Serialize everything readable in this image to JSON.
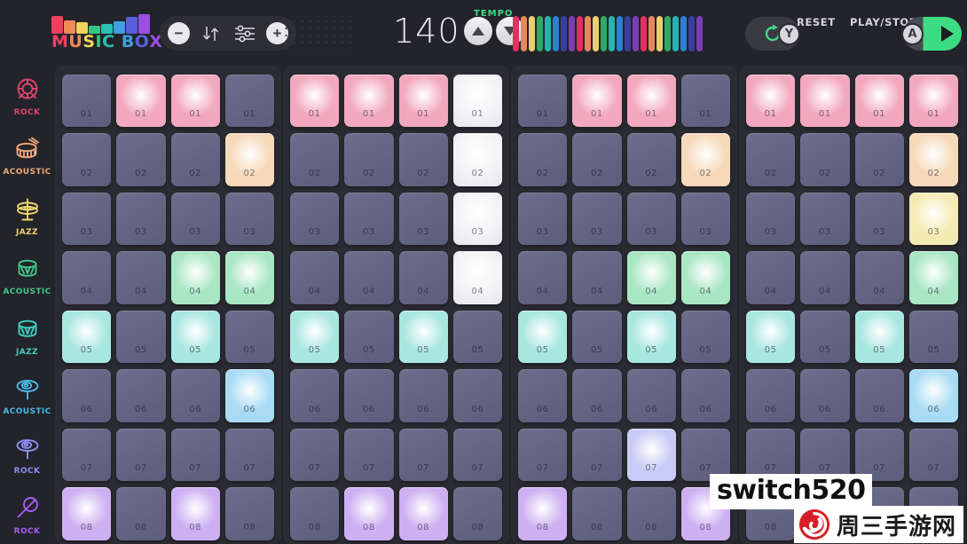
{
  "header": {
    "logo": {
      "text_parts": [
        {
          "ch": "M",
          "color": "#ef4060"
        },
        {
          "ch": "U",
          "color": "#f28a5a"
        },
        {
          "ch": "S",
          "color": "#f2d45a"
        },
        {
          "ch": "I",
          "color": "#34c77b"
        },
        {
          "ch": "C",
          "color": "#2bbfb0"
        },
        {
          "ch": " ",
          "color": "#ffffff"
        },
        {
          "ch": "B",
          "color": "#3f9fe0"
        },
        {
          "ch": "O",
          "color": "#5a5fd8"
        },
        {
          "ch": "X",
          "color": "#9a4fe0"
        }
      ],
      "bars": [
        {
          "color": "#ef4060",
          "height": 20
        },
        {
          "color": "#f28a5a",
          "height": 15
        },
        {
          "color": "#f2d45a",
          "height": 13
        },
        {
          "color": "#34c77b",
          "height": 9
        },
        {
          "color": "#2bbfb0",
          "height": 11
        },
        {
          "color": "#3f9fe0",
          "height": 14
        },
        {
          "color": "#5a5fd8",
          "height": 19
        },
        {
          "color": "#9a4fe0",
          "height": 22
        }
      ]
    },
    "toolbar": {
      "minus_label": "−",
      "plus_label": "+",
      "sort_icon_name": "sort-up-down-icon",
      "settings_icon_name": "sliders-icon"
    },
    "tempo": {
      "value": "140",
      "label": "TEMPO",
      "label_color": "#3ddc84",
      "up_name": "tempo-up-button",
      "down_name": "tempo-down-button"
    },
    "visualizer": {
      "palette": [
        "#e0315f",
        "#e5895c",
        "#e9cf72",
        "#2fa86a",
        "#27b3b0",
        "#2f7fd0",
        "#3a3f9e",
        "#7a3fb0"
      ],
      "bar_count": 24
    },
    "reset": {
      "label": "RESET",
      "badge": "Y",
      "icon_name": "refresh-icon",
      "accent": "#3ddc84"
    },
    "play": {
      "label": "PLAY/STOP",
      "badge": "A",
      "icon_name": "play-icon",
      "accent": "#3ddc84"
    }
  },
  "sidebar": {
    "items": [
      {
        "label": "ROCK",
        "color": "#e0436e",
        "icon": "rock-kick-drum-icon"
      },
      {
        "label": "ACOUSTIC",
        "color": "#f0a878",
        "icon": "acoustic-snare-drum-icon"
      },
      {
        "label": "JAZZ",
        "color": "#ecd66a",
        "icon": "jazz-hihat-icon"
      },
      {
        "label": "ACOUSTIC",
        "color": "#3fc98b",
        "icon": "acoustic-tom-drum-icon"
      },
      {
        "label": "JAZZ",
        "color": "#3fd0c0",
        "icon": "jazz-tom-drum-icon"
      },
      {
        "label": "ACOUSTIC",
        "color": "#4ab8e8",
        "icon": "acoustic-cymbal-icon"
      },
      {
        "label": "ROCK",
        "color": "#8a8ef0",
        "icon": "rock-cymbal-icon"
      },
      {
        "label": "ROCK",
        "color": "#a45ef0",
        "icon": "rock-shaker-icon"
      }
    ]
  },
  "grid": {
    "group_count": 4,
    "columns_per_group": 4,
    "row_labels": [
      "01",
      "02",
      "03",
      "04",
      "05",
      "06",
      "07",
      "08"
    ],
    "row_colors": [
      "#f2a8bf",
      "#f6d9b8",
      "#f4ebb4",
      "#a9e6c4",
      "#a8e6e0",
      "#a9dcf4",
      "#c8cbf6",
      "#cdb0f2"
    ],
    "playhead": {
      "group": 1,
      "column": 3,
      "rows": [
        0,
        1,
        2,
        3
      ]
    },
    "steps": [
      [
        0,
        1,
        1,
        0,
        1,
        1,
        1,
        0,
        0,
        1,
        1,
        0,
        1,
        1,
        1,
        1
      ],
      [
        0,
        0,
        0,
        1,
        0,
        0,
        0,
        0,
        0,
        0,
        0,
        1,
        0,
        0,
        0,
        1
      ],
      [
        0,
        0,
        0,
        0,
        0,
        0,
        0,
        0,
        0,
        0,
        0,
        0,
        0,
        0,
        0,
        1
      ],
      [
        0,
        0,
        1,
        1,
        0,
        0,
        0,
        0,
        0,
        0,
        1,
        1,
        0,
        0,
        0,
        1
      ],
      [
        1,
        0,
        1,
        0,
        1,
        0,
        1,
        0,
        1,
        0,
        1,
        0,
        1,
        0,
        1,
        0
      ],
      [
        0,
        0,
        0,
        1,
        0,
        0,
        0,
        0,
        0,
        0,
        0,
        0,
        0,
        0,
        0,
        1
      ],
      [
        0,
        0,
        0,
        0,
        0,
        0,
        0,
        0,
        0,
        0,
        1,
        0,
        0,
        0,
        0,
        0
      ],
      [
        1,
        0,
        1,
        0,
        0,
        1,
        1,
        0,
        1,
        0,
        0,
        1,
        0,
        0,
        0,
        0
      ]
    ]
  },
  "watermark": {
    "text": "switch520",
    "brand": "周三手游网",
    "spiral_color": "#d62027"
  }
}
